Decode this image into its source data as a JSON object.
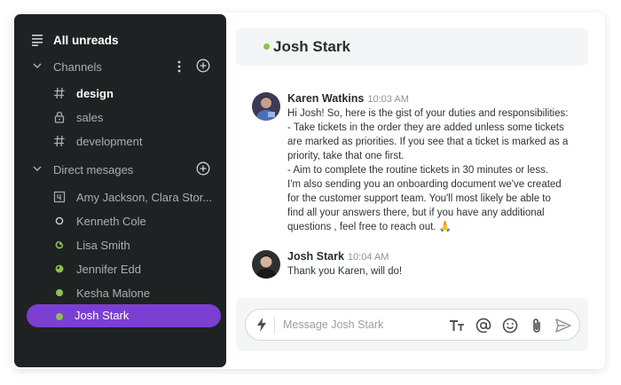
{
  "sidebar": {
    "all_unreads": "All unreads",
    "channels_label": "Channels",
    "channels": [
      {
        "label": "design",
        "icon": "hash-icon",
        "bold": true
      },
      {
        "label": "sales",
        "icon": "lock-icon"
      },
      {
        "label": "development",
        "icon": "hash-icon"
      }
    ],
    "dm_label": "Direct mesages",
    "dms": [
      {
        "label": "Amy Jackson, Clara Stor...",
        "icon": "group-dm-icon"
      },
      {
        "label": "Kenneth Cole",
        "icon": "status-offline-icon"
      },
      {
        "label": "Lisa Smith",
        "icon": "status-partial-icon"
      },
      {
        "label": "Jennifer Edd",
        "icon": "status-mostly-icon"
      },
      {
        "label": "Kesha Malone",
        "icon": "status-online-icon"
      },
      {
        "label": "Josh Stark",
        "icon": "status-online-icon",
        "active": true
      }
    ],
    "colors": {
      "bg": "#1f2223",
      "active": "#7b3fd1",
      "online": "#8bc34a"
    }
  },
  "chat": {
    "title": "Josh Stark",
    "messages": [
      {
        "author": "Karen Watkins",
        "time": "10:03 AM",
        "lines": [
          "Hi Josh! So, here is the gist of your duties and responsibilities:",
          "- Take tickets in the order they are added unless some tickets",
          "are marked as priorities. If you see that a ticket is marked as a",
          "priority, take that one first.",
          "- Aim to complete the routine tickets in 30 minutes or less.",
          "I'm also sending you an onboarding document we've created",
          "for the customer support team. You'll most likely be able to",
          "find all your answers there, but if you have any additional",
          "questions , feel free to reach out. 🙏"
        ]
      },
      {
        "author": "Josh Stark",
        "time": "10:04 AM",
        "lines": [
          "Thank you Karen, will do!"
        ]
      }
    ],
    "composer": {
      "placeholder": "Message Josh Stark",
      "tools": [
        "text-format-icon",
        "mention-icon",
        "emoji-icon",
        "attachment-icon",
        "send-icon"
      ]
    }
  }
}
